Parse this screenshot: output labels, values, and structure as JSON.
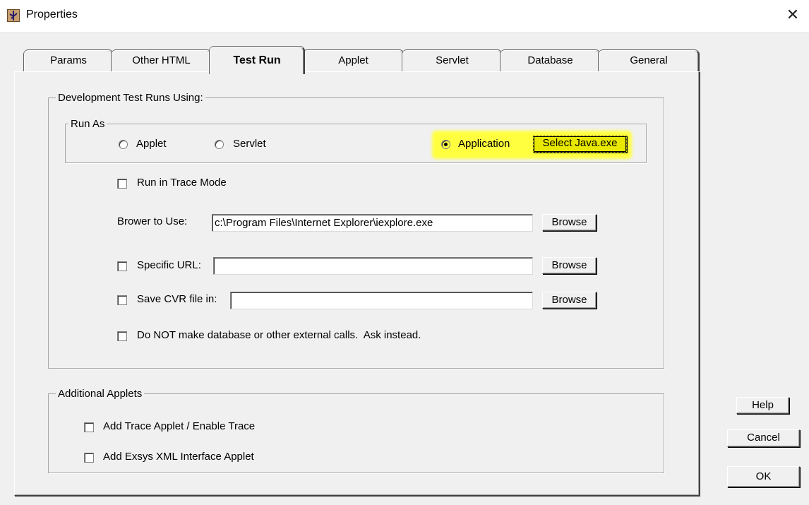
{
  "window": {
    "title": "Properties",
    "close_glyph": "✕"
  },
  "tabs": [
    {
      "label": "Params",
      "active": false
    },
    {
      "label": "Other HTML",
      "active": false
    },
    {
      "label": "Test Run",
      "active": true
    },
    {
      "label": "Applet",
      "active": false
    },
    {
      "label": "Servlet",
      "active": false
    },
    {
      "label": "Database",
      "active": false
    },
    {
      "label": "General",
      "active": false
    }
  ],
  "dev_group": {
    "legend": "Development Test Runs Using:",
    "run_as": {
      "legend": "Run As",
      "options": [
        {
          "label": "Applet",
          "selected": false
        },
        {
          "label": "Servlet",
          "selected": false
        },
        {
          "label": "Application",
          "selected": true
        }
      ],
      "select_java_label": "Select Java.exe",
      "highlight_color": "#ffff00"
    },
    "trace_mode": {
      "label": "Run in Trace Mode",
      "checked": false
    },
    "browser": {
      "label": "Brower to Use:",
      "value": "c:\\Program Files\\Internet Explorer\\iexplore.exe",
      "browse_label": "Browse"
    },
    "specific_url": {
      "label": "Specific URL:",
      "checked": false,
      "value": "",
      "browse_label": "Browse"
    },
    "save_cvr": {
      "label": "Save CVR file in:",
      "checked": false,
      "value": "",
      "browse_label": "Browse"
    },
    "no_external": {
      "label": "Do NOT make database or other external calls.  Ask instead.",
      "checked": false
    }
  },
  "additional_group": {
    "legend": "Additional Applets",
    "items": [
      {
        "label": "Add Trace Applet / Enable Trace",
        "checked": false
      },
      {
        "label": "Add Exsys XML Interface Applet",
        "checked": false
      }
    ]
  },
  "buttons": {
    "help": "Help",
    "cancel": "Cancel",
    "ok": "OK"
  }
}
